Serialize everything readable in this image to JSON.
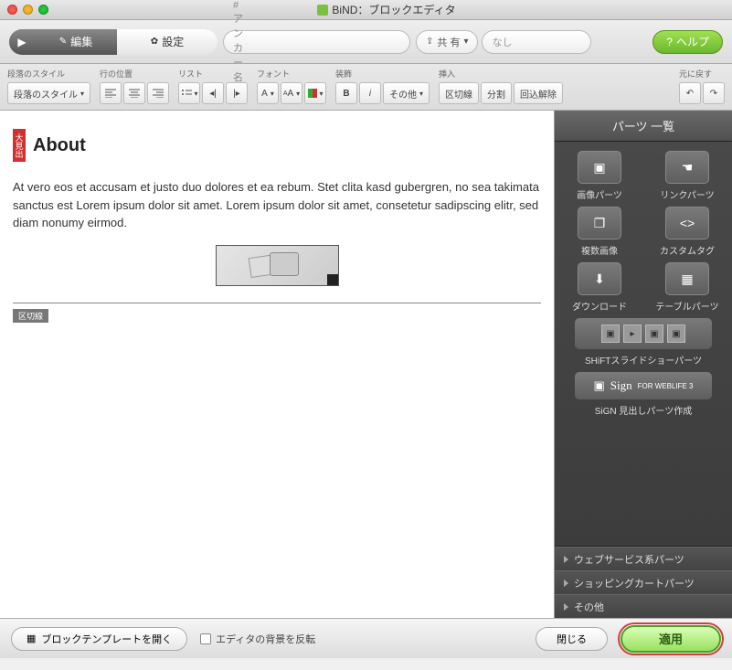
{
  "window": {
    "title": "BiND：ブロックエディタ"
  },
  "toolbar1": {
    "edit": "編集",
    "settings": "設定",
    "anchor_label": "#アンカー名",
    "share": "共 有",
    "share_value": "なし",
    "help": "ヘルプ"
  },
  "toolbar2": {
    "groups": {
      "para_style": {
        "label": "段落のスタイル",
        "button": "段落のスタイル"
      },
      "line_pos": {
        "label": "行の位置"
      },
      "list": {
        "label": "リスト"
      },
      "font": {
        "label": "フォント"
      },
      "decoration": {
        "label": "装飾",
        "other": "その他"
      },
      "insert": {
        "label": "挿入",
        "hr": "区切線",
        "split": "分割",
        "unwrap": "回込解除"
      },
      "revert": {
        "label": "元に戻す"
      }
    }
  },
  "content": {
    "heading_badge": "大見出",
    "heading": "About",
    "body": "At vero eos et accusam et justo duo dolores et ea rebum. Stet clita kasd gubergren, no sea takimata sanctus est Lorem ipsum dolor sit amet. Lorem ipsum dolor sit amet, consetetur sadipscing elitr, sed diam nonumy eirmod.",
    "hr_label": "区切線"
  },
  "panel": {
    "title": "パーツ 一覧",
    "parts": [
      {
        "label": "画像パーツ"
      },
      {
        "label": "リンクパーツ"
      },
      {
        "label": "複数画像"
      },
      {
        "label": "カスタムタグ"
      },
      {
        "label": "ダウンロード"
      },
      {
        "label": "テーブルパーツ"
      }
    ],
    "slideshow": "SHiFTスライドショーパーツ",
    "sign_brand": "Sign",
    "sign_sub": "FOR WEBLIFE 3",
    "sign_label": "SiGN 見出しパーツ作成",
    "accordion": [
      "ウェブサービス系パーツ",
      "ショッピングカートパーツ",
      "その他"
    ]
  },
  "bottom": {
    "template": "ブロックテンプレートを開く",
    "invert_bg": "エディタの背景を反転",
    "close": "閉じる",
    "apply": "適用"
  }
}
